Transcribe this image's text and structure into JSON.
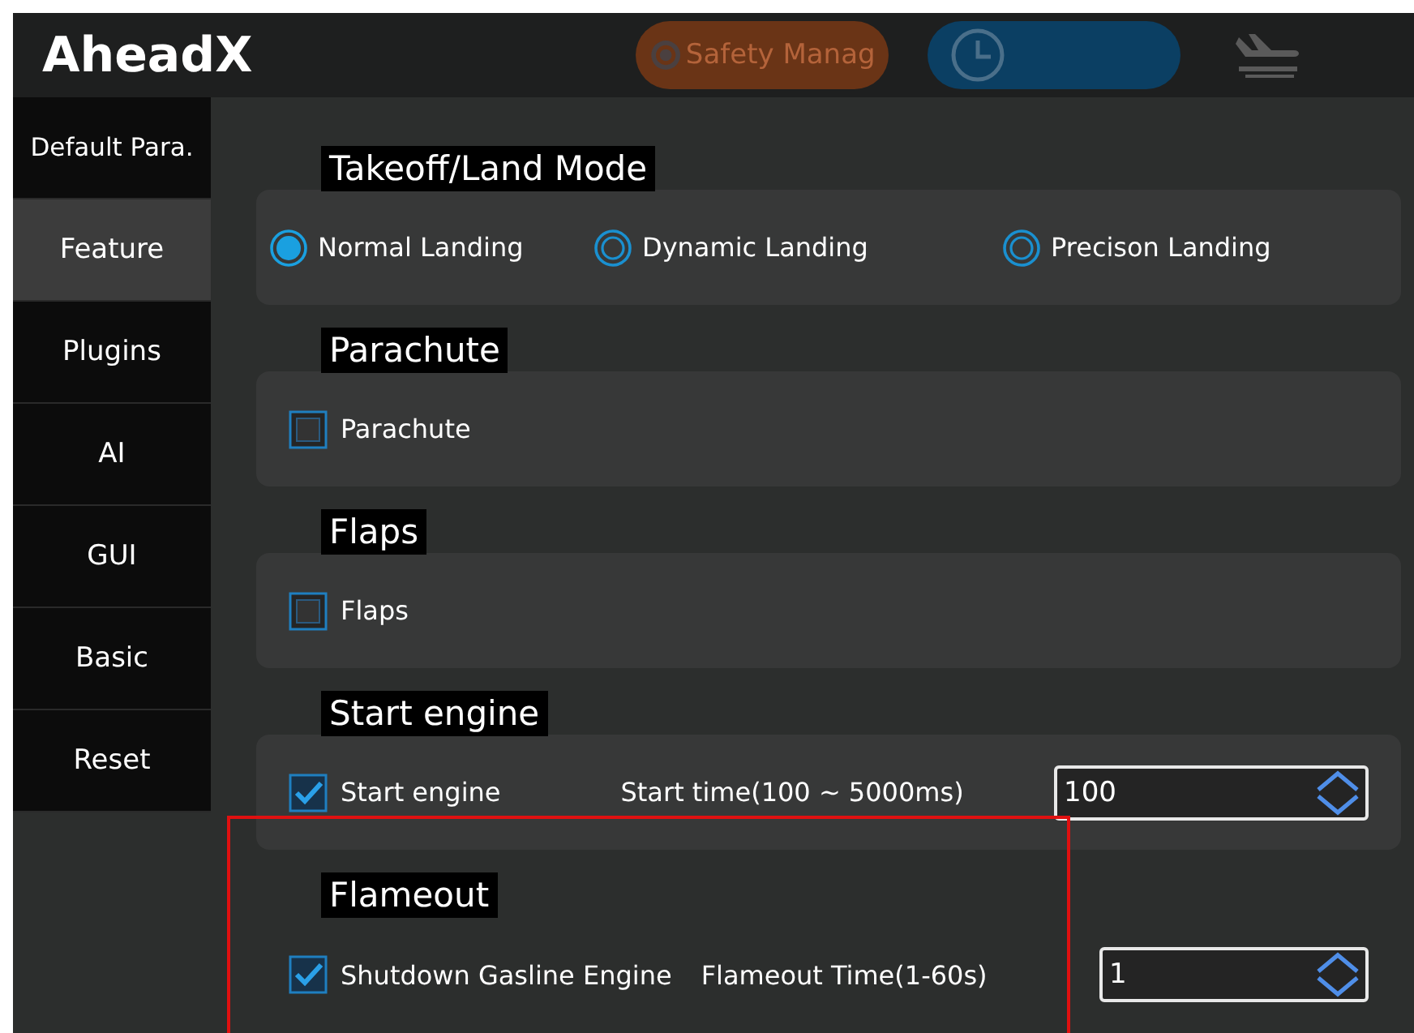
{
  "header": {
    "logo": "AheadX",
    "safety_button": "Safety Manag"
  },
  "sidebar": {
    "items": [
      {
        "label": "Default Para.",
        "selected": false
      },
      {
        "label": "Feature",
        "selected": true
      },
      {
        "label": "Plugins",
        "selected": false
      },
      {
        "label": "AI",
        "selected": false
      },
      {
        "label": "GUI",
        "selected": false
      },
      {
        "label": "Basic",
        "selected": false
      },
      {
        "label": "Reset",
        "selected": false
      }
    ]
  },
  "sections": [
    {
      "title": "Takeoff/Land Mode",
      "kind": "radio",
      "card": true,
      "highlighted": false,
      "options": [
        {
          "label": "Normal Landing",
          "selected": true
        },
        {
          "label": "Dynamic Landing",
          "selected": false
        },
        {
          "label": "Precison Landing",
          "selected": false
        }
      ]
    },
    {
      "title": "Parachute",
      "kind": "checkbox",
      "card": true,
      "highlighted": false,
      "items": [
        {
          "label": "Parachute",
          "checked": false
        }
      ]
    },
    {
      "title": "Flaps",
      "kind": "checkbox",
      "card": true,
      "highlighted": false,
      "items": [
        {
          "label": "Flaps",
          "checked": false
        }
      ]
    },
    {
      "title": "Start engine",
      "kind": "checkbox",
      "card": true,
      "highlighted": false,
      "items": [
        {
          "label": "Start engine",
          "checked": true
        }
      ],
      "field": {
        "label": "Start time(100 ~ 5000ms)",
        "value": "100"
      }
    },
    {
      "title": "Flameout",
      "kind": "checkbox",
      "card": false,
      "highlighted": true,
      "items": [
        {
          "label": "Shutdown Gasline Engine",
          "checked": true
        }
      ],
      "field": {
        "label": "Flameout Time(1-60s)",
        "value": "1"
      }
    }
  ]
}
